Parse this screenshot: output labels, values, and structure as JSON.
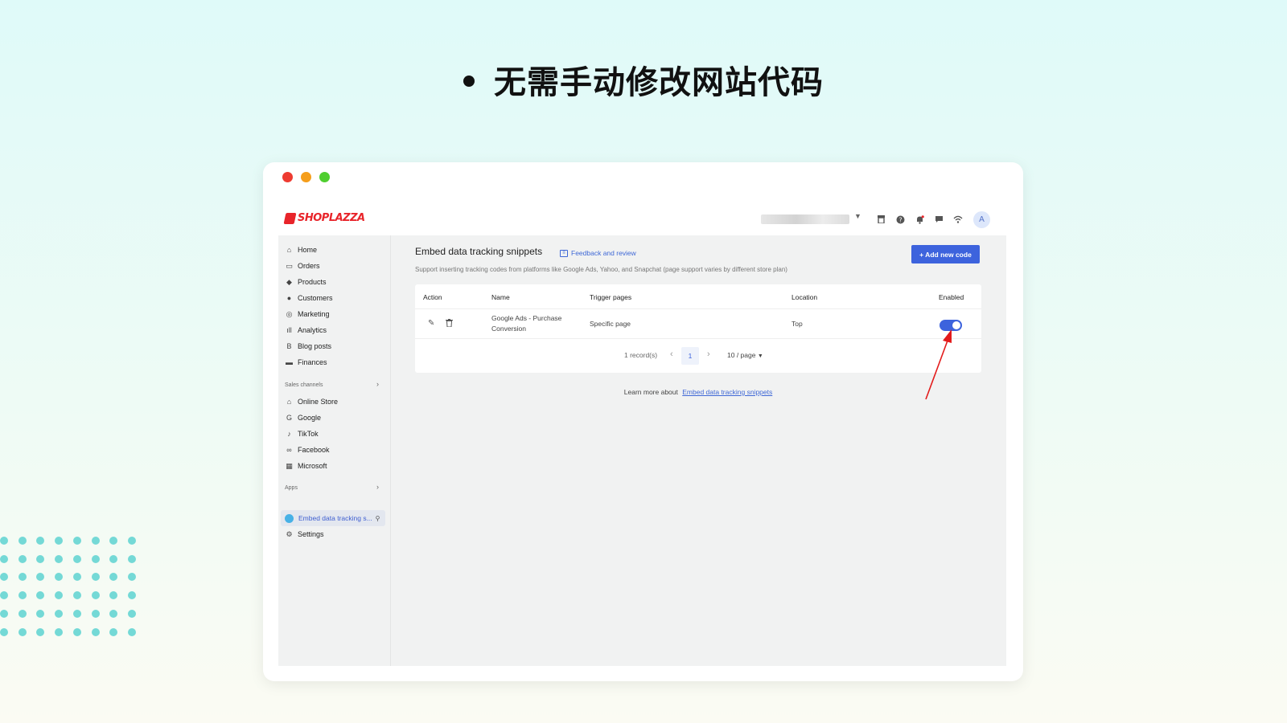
{
  "headline": "无需手动修改网站代码",
  "app": {
    "logo_text": "SHOPLAZZA",
    "avatar_letter": "A",
    "top_icons": [
      "store-icon",
      "help-icon",
      "bell-icon",
      "message-icon",
      "wifi-icon"
    ]
  },
  "sidebar": {
    "items": [
      {
        "label": "Home",
        "icon": "home-icon"
      },
      {
        "label": "Orders",
        "icon": "orders-icon"
      },
      {
        "label": "Products",
        "icon": "tag-icon"
      },
      {
        "label": "Customers",
        "icon": "user-icon"
      },
      {
        "label": "Marketing",
        "icon": "marketing-icon"
      },
      {
        "label": "Analytics",
        "icon": "bar-chart-icon"
      },
      {
        "label": "Blog posts",
        "icon": "blog-icon"
      },
      {
        "label": "Finances",
        "icon": "finance-icon"
      }
    ],
    "sales_channels_label": "Sales channels",
    "channels": [
      {
        "label": "Online Store",
        "icon": "store-icon"
      },
      {
        "label": "Google",
        "icon": "google-icon"
      },
      {
        "label": "TikTok",
        "icon": "tiktok-icon"
      },
      {
        "label": "Facebook",
        "icon": "meta-icon"
      },
      {
        "label": "Microsoft",
        "icon": "microsoft-icon"
      }
    ],
    "apps_label": "Apps",
    "active_app": "Embed data tracking s...",
    "settings_label": "Settings"
  },
  "main": {
    "title": "Embed data tracking snippets",
    "feedback_link": "Feedback and review",
    "add_button": "+ Add new code",
    "subtitle": "Support inserting tracking codes from platforms like Google Ads, Yahoo, and Snapchat (page support varies by different store plan)",
    "table": {
      "headers": [
        "Action",
        "Name",
        "Trigger pages",
        "Location",
        "Enabled"
      ],
      "rows": [
        {
          "name": "Google Ads - Purchase Conversion",
          "trigger": "Specific page",
          "location": "Top",
          "enabled": true
        }
      ]
    },
    "pagination": {
      "records": "1 record(s)",
      "current_page": "1",
      "page_size": "10 / page"
    },
    "learn_more_prefix": "Learn more about",
    "learn_more_link": "Embed data tracking snippets"
  },
  "colors": {
    "accent": "#3d63dd",
    "annotation_arrow": "#e31b1b"
  }
}
